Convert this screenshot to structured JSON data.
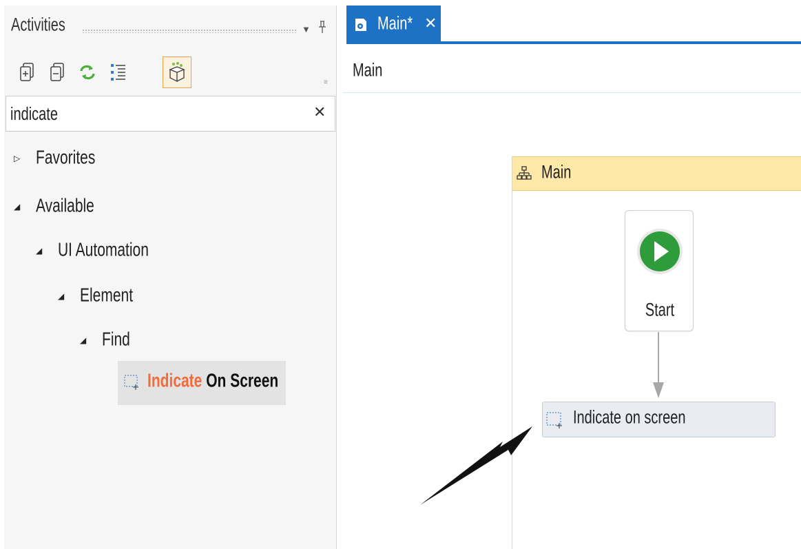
{
  "activities_panel": {
    "title": "Activities",
    "search": {
      "value": "indicate",
      "placeholder": ""
    },
    "toolbar": [
      "expand-all-icon",
      "collapse-all-icon",
      "refresh-icon",
      "show-tree-icon",
      "available-packages-icon"
    ],
    "tree": {
      "favorites": "Favorites",
      "available": "Available",
      "ui_automation": "UI Automation",
      "element": "Element",
      "find": "Find"
    },
    "result": {
      "highlight": "Indicate",
      "rest": " On Screen"
    }
  },
  "designer": {
    "tab": {
      "label": "Main*"
    },
    "breadcrumb": "Main",
    "flowchart": {
      "title": "Main",
      "start_label": "Start",
      "activity_label": "Indicate on screen"
    }
  },
  "colors": {
    "accent": "#1d72c6",
    "search_highlight": "#f26b3a",
    "flowchart_header": "#fde8a8",
    "start_green": "#2e9c3a"
  }
}
